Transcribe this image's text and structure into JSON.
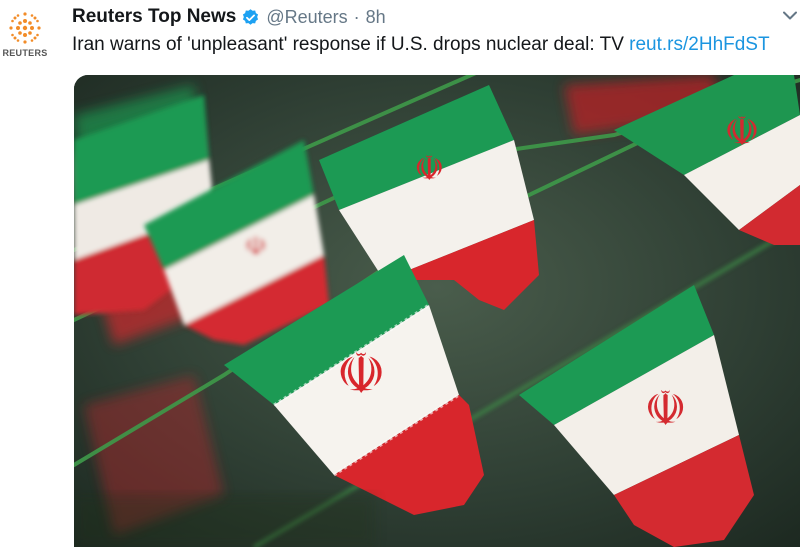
{
  "account": {
    "logo_text": "REUTERS",
    "name": "Reuters Top News",
    "handle": "@Reuters",
    "separator": "·",
    "time": "8h"
  },
  "tweet": {
    "text": "Iran warns of 'unpleasant' response if U.S. drops nuclear deal: TV ",
    "link": "reut.rs/2HhFdST"
  },
  "icons": {
    "verified": "verified-badge-icon",
    "more": "chevron-down-icon",
    "logo": "reuters-logo-icon"
  },
  "colors": {
    "link": "#1b95e0",
    "verified": "#1da1f2",
    "flag_green": "#1f9a52",
    "flag_red": "#d8232a",
    "reuters_orange": "#f28c28"
  }
}
